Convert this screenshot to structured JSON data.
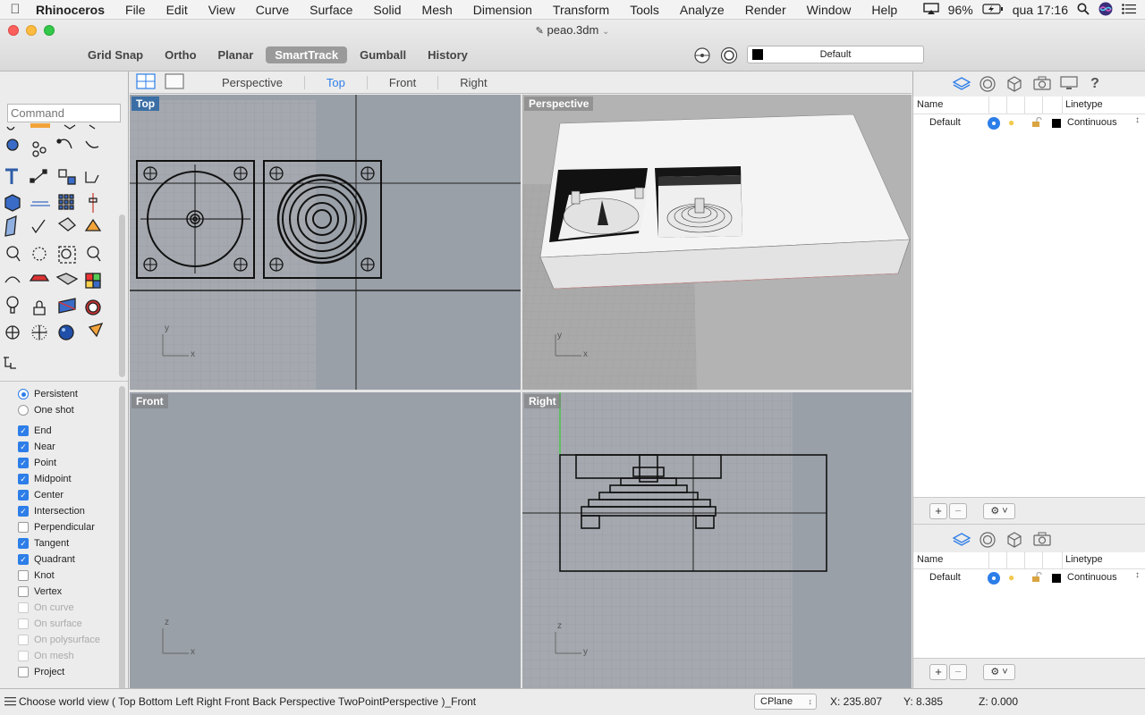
{
  "menubar": {
    "items": [
      "Rhinoceros",
      "File",
      "Edit",
      "View",
      "Curve",
      "Surface",
      "Solid",
      "Mesh",
      "Dimension",
      "Transform",
      "Tools",
      "Analyze",
      "Render",
      "Window",
      "Help"
    ],
    "battery": "96%",
    "clock": "qua 17:16"
  },
  "window": {
    "title": "peao.3dm"
  },
  "modes": [
    "Grid Snap",
    "Ortho",
    "Planar",
    "SmartTrack",
    "Gumball",
    "History"
  ],
  "active_mode": "SmartTrack",
  "layer_combo": {
    "value": "Default"
  },
  "command": {
    "placeholder": "Command"
  },
  "view_tabs": [
    "Perspective",
    "Top",
    "Front",
    "Right"
  ],
  "active_view_tab": "Top",
  "viewports": {
    "top": "Top",
    "perspective": "Perspective",
    "front": "Front",
    "right": "Right"
  },
  "osnap_mode": {
    "persistent": "Persistent",
    "one_shot": "One shot"
  },
  "osnaps": [
    {
      "label": "End",
      "checked": true,
      "enabled": true
    },
    {
      "label": "Near",
      "checked": true,
      "enabled": true
    },
    {
      "label": "Point",
      "checked": true,
      "enabled": true
    },
    {
      "label": "Midpoint",
      "checked": true,
      "enabled": true
    },
    {
      "label": "Center",
      "checked": true,
      "enabled": true
    },
    {
      "label": "Intersection",
      "checked": true,
      "enabled": true
    },
    {
      "label": "Perpendicular",
      "checked": false,
      "enabled": true
    },
    {
      "label": "Tangent",
      "checked": true,
      "enabled": true
    },
    {
      "label": "Quadrant",
      "checked": true,
      "enabled": true
    },
    {
      "label": "Knot",
      "checked": false,
      "enabled": true
    },
    {
      "label": "Vertex",
      "checked": false,
      "enabled": true
    },
    {
      "label": "On curve",
      "checked": false,
      "enabled": false
    },
    {
      "label": "On surface",
      "checked": false,
      "enabled": false
    },
    {
      "label": "On polysurface",
      "checked": false,
      "enabled": false
    },
    {
      "label": "On mesh",
      "checked": false,
      "enabled": false
    },
    {
      "label": "Project",
      "checked": false,
      "enabled": true
    }
  ],
  "layers_panel": {
    "col_name": "Name",
    "col_linetype": "Linetype",
    "rows": [
      {
        "name": "Default",
        "linetype": "Continuous"
      }
    ]
  },
  "layers_panel_2": {
    "col_name": "Name",
    "col_linetype": "Linetype",
    "rows": [
      {
        "name": "Default",
        "linetype": "Continuous"
      }
    ]
  },
  "axis_labels": {
    "x": "x",
    "y": "y",
    "z": "z"
  },
  "status": {
    "prompt": "Choose world view ( Top Bottom Left Right Front Back Perspective TwoPointPerspective )_Front",
    "cplane": "CPlane",
    "x": "X: 235.807",
    "y": "Y: 8.385",
    "z": "Z: 0.000"
  },
  "colors": {
    "accent": "#2d7ee8",
    "viewport_bg": "#9aa0a8",
    "grid_area": "#a7abb1",
    "perspective_bg": "#b4b4b4"
  }
}
